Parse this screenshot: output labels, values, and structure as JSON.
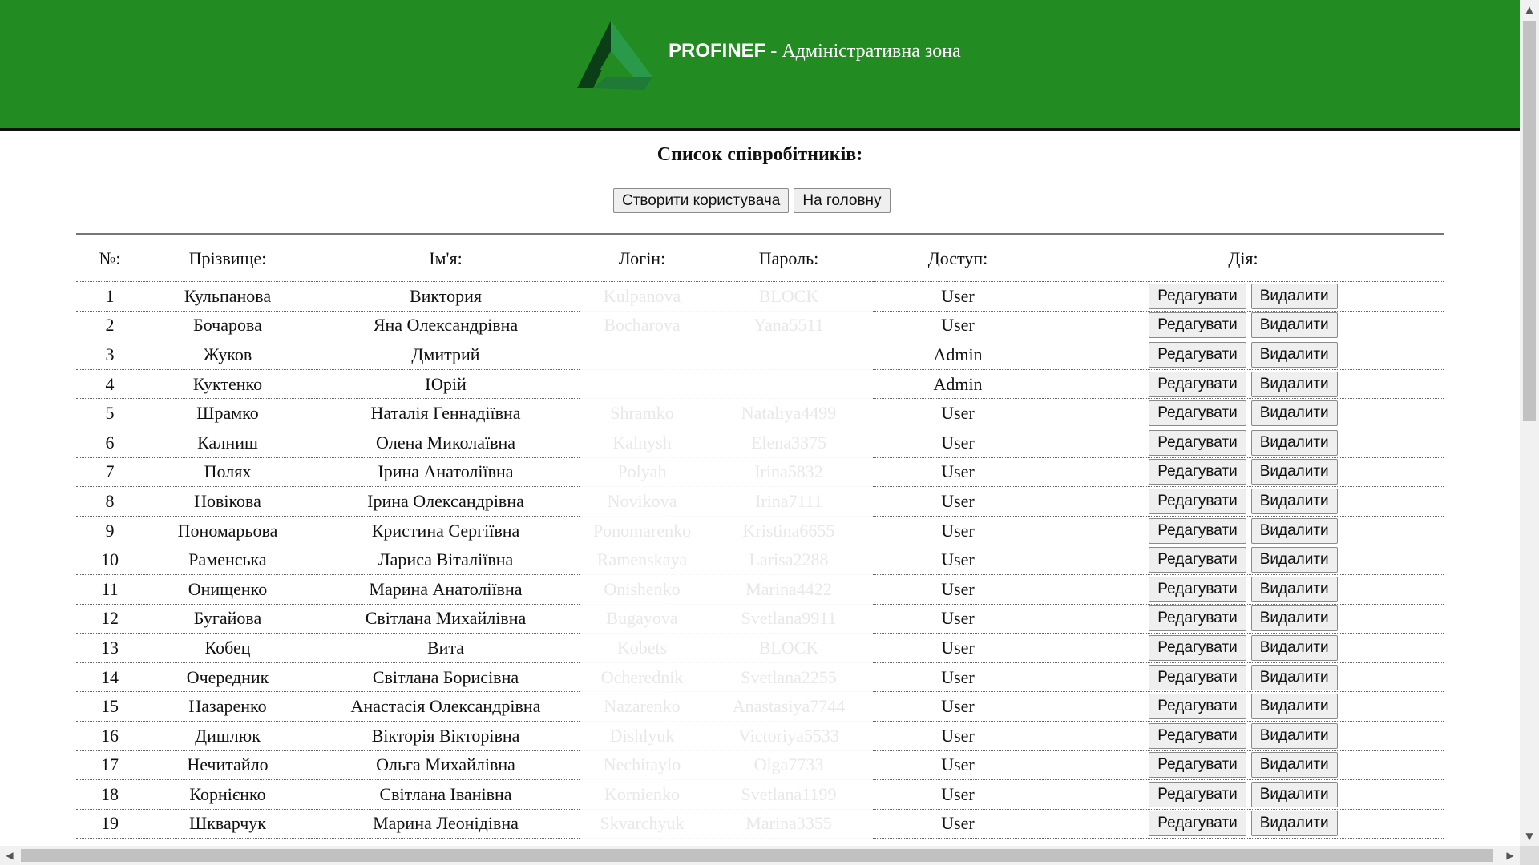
{
  "header": {
    "brand_name": "PROFINEF",
    "brand_suffix": " - Адміністративна зона",
    "logo_colors": [
      "#0b3d16",
      "#2a9a4a",
      "#1e7a36"
    ]
  },
  "page": {
    "title": "Список співробітників:",
    "create_button": "Створити користувача",
    "home_button": "На головну"
  },
  "table": {
    "columns": [
      "№:",
      "Прізвище:",
      "Ім'я:",
      "Логін:",
      "Пароль:",
      "Доступ:",
      "Дія:"
    ],
    "edit_label": "Редагувати",
    "delete_label": "Видалити",
    "rows": [
      {
        "num": "1",
        "surname": "Кульпанова",
        "name": "Виктория",
        "login": "Kulpanova",
        "password": "BLOCK",
        "access": "User"
      },
      {
        "num": "2",
        "surname": "Бочарова",
        "name": "Яна Олександрівна",
        "login": "Bocharova",
        "password": "Yana5511",
        "access": "User"
      },
      {
        "num": "3",
        "surname": "Жуков",
        "name": "Дмитрий",
        "login": "",
        "password": "",
        "access": "Admin"
      },
      {
        "num": "4",
        "surname": "Куктенко",
        "name": "Юрій",
        "login": "",
        "password": "",
        "access": "Admin"
      },
      {
        "num": "5",
        "surname": "Шрамко",
        "name": "Наталія Геннадіївна",
        "login": "Shramko",
        "password": "Nataliya4499",
        "access": "User"
      },
      {
        "num": "6",
        "surname": "Калниш",
        "name": "Олена Миколаївна",
        "login": "Kalnysh",
        "password": "Elena3375",
        "access": "User"
      },
      {
        "num": "7",
        "surname": "Полях",
        "name": "Ірина Анатоліївна",
        "login": "Polyah",
        "password": "Irina5832",
        "access": "User"
      },
      {
        "num": "8",
        "surname": "Новікова",
        "name": "Ірина Олександрівна",
        "login": "Novikova",
        "password": "Irina7111",
        "access": "User"
      },
      {
        "num": "9",
        "surname": "Пономарьова",
        "name": "Кристина Сергіївна",
        "login": "Ponomarenko",
        "password": "Kristina6655",
        "access": "User"
      },
      {
        "num": "10",
        "surname": "Раменська",
        "name": "Лариса Віталіївна",
        "login": "Ramenskaya",
        "password": "Larisa2288",
        "access": "User"
      },
      {
        "num": "11",
        "surname": "Онищенко",
        "name": "Марина Анатоліївна",
        "login": "Onishenko",
        "password": "Marina4422",
        "access": "User"
      },
      {
        "num": "12",
        "surname": "Бугайова",
        "name": "Світлана Михайлівна",
        "login": "Bugayova",
        "password": "Svetlana9911",
        "access": "User"
      },
      {
        "num": "13",
        "surname": "Кобец",
        "name": "Вита",
        "login": "Kobets",
        "password": "BLOCK",
        "access": "User"
      },
      {
        "num": "14",
        "surname": "Очередник",
        "name": "Світлана Борисівна",
        "login": "Ocherednik",
        "password": "Svetlana2255",
        "access": "User"
      },
      {
        "num": "15",
        "surname": "Назаренко",
        "name": "Анастасія Олександрівна",
        "login": "Nazarenko",
        "password": "Anastasiya7744",
        "access": "User"
      },
      {
        "num": "16",
        "surname": "Дишлюк",
        "name": "Вікторія Вікторівна",
        "login": "Dishlyuk",
        "password": "Victoriya5533",
        "access": "User"
      },
      {
        "num": "17",
        "surname": "Нечитайло",
        "name": "Ольга Михайлівна",
        "login": "Nechitaylo",
        "password": "Olga7733",
        "access": "User"
      },
      {
        "num": "18",
        "surname": "Корнієнко",
        "name": "Світлана Іванівна",
        "login": "Kornienko",
        "password": "Svetlana1199",
        "access": "User"
      },
      {
        "num": "19",
        "surname": "Шкварчук",
        "name": "Марина Леонідівна",
        "login": "Skvarchyuk",
        "password": "Marina3355",
        "access": "User"
      }
    ]
  },
  "scrollbars": {
    "up_icon": "▲",
    "down_icon": "▼",
    "left_icon": "◀",
    "right_icon": "▶"
  }
}
